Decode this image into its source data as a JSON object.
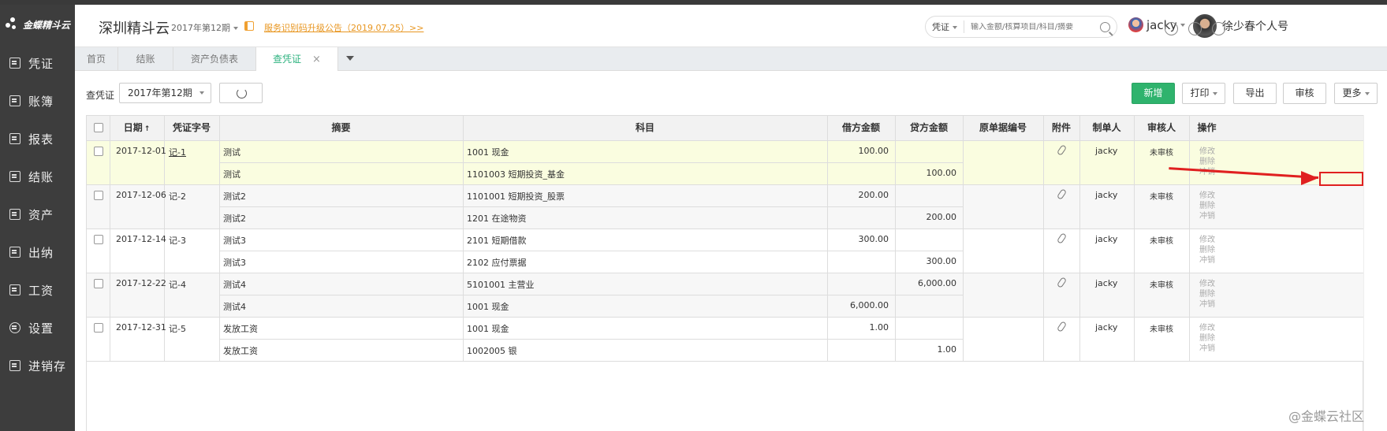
{
  "sidebar": {
    "logo": "金蝶精斗云",
    "items": [
      {
        "label": "凭证"
      },
      {
        "label": "账簿"
      },
      {
        "label": "报表"
      },
      {
        "label": "结账"
      },
      {
        "label": "资产"
      },
      {
        "label": "出纳"
      },
      {
        "label": "工资"
      },
      {
        "label": "设置"
      },
      {
        "label": "进销存"
      }
    ]
  },
  "header": {
    "brand": "深圳精斗云",
    "period": "2017年第12期",
    "notice": "服务识别码升级公告（2019.07.25）>>",
    "search_type": "凭证",
    "search_placeholder": "输入金额/核算项目/科目/摘要",
    "user": "jacky",
    "account": "徐少春个人号"
  },
  "tabs": [
    {
      "label": "首页"
    },
    {
      "label": "结账"
    },
    {
      "label": "资产负债表"
    },
    {
      "label": "查凭证"
    }
  ],
  "toolbar": {
    "label": "查凭证",
    "period": "2017年第12期",
    "new": "新增",
    "print": "打印",
    "export": "导出",
    "audit": "审核",
    "more": "更多"
  },
  "table": {
    "headers": [
      "日期",
      "凭证字号",
      "摘要",
      "科目",
      "借方金额",
      "贷方金额",
      "原单据编号",
      "附件",
      "制单人",
      "审核人",
      "操作"
    ],
    "sort_indicator": "↑",
    "ops": [
      "修改",
      "删除",
      "冲销"
    ],
    "vouchers": [
      {
        "date": "2017-12-01",
        "no": "记-1",
        "maker": "jacky",
        "status": "未审核",
        "lines": [
          {
            "summary": "测试",
            "account": "1001 现金",
            "debit": "100.00",
            "credit": ""
          },
          {
            "summary": "测试",
            "account": "1101003 短期投资_基金",
            "debit": "",
            "credit": "100.00"
          }
        ]
      },
      {
        "date": "2017-12-06",
        "no": "记-2",
        "maker": "jacky",
        "status": "未审核",
        "lines": [
          {
            "summary": "测试2",
            "account": "1101001 短期投资_股票",
            "debit": "200.00",
            "credit": ""
          },
          {
            "summary": "测试2",
            "account": "1201 在途物资",
            "debit": "",
            "credit": "200.00"
          }
        ]
      },
      {
        "date": "2017-12-14",
        "no": "记-3",
        "maker": "jacky",
        "status": "未审核",
        "lines": [
          {
            "summary": "测试3",
            "account": "2101 短期借款",
            "debit": "300.00",
            "credit": ""
          },
          {
            "summary": "测试3",
            "account": "2102 应付票据",
            "debit": "",
            "credit": "300.00"
          }
        ]
      },
      {
        "date": "2017-12-22",
        "no": "记-4",
        "maker": "jacky",
        "status": "未审核",
        "lines": [
          {
            "summary": "测试4",
            "account": "5101001 主营业",
            "debit": "",
            "credit": "6,000.00"
          },
          {
            "summary": "测试4",
            "account": "1001 现金",
            "debit": "6,000.00",
            "credit": ""
          }
        ]
      },
      {
        "date": "2017-12-31",
        "no": "记-5",
        "maker": "jacky",
        "status": "未审核",
        "lines": [
          {
            "summary": "发放工资",
            "account": "1001 现金",
            "debit": "1.00",
            "credit": ""
          },
          {
            "summary": "发放工资",
            "account": "1002005 银",
            "debit": "",
            "credit": "1.00"
          }
        ]
      }
    ]
  },
  "watermark": "@金蝶云社区",
  "colors": {
    "primary": "#2fb36d",
    "highlight_row": "#fafde0",
    "annotation": "#e02020",
    "notice": "#e89620"
  }
}
